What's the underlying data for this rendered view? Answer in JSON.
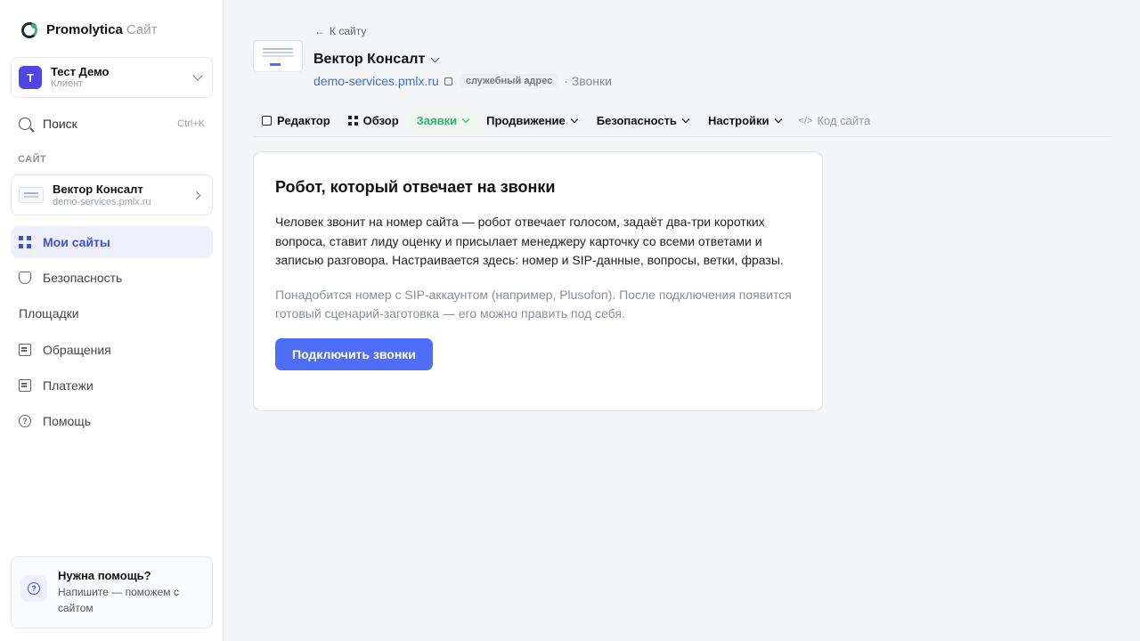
{
  "brand": {
    "name": "Promolytica",
    "suffix": "Сайт"
  },
  "account": {
    "initial": "Т",
    "name": "Тест Демо",
    "role": "Клиент"
  },
  "search": {
    "label": "Поиск",
    "shortcut": "Ctrl+K"
  },
  "sidebar": {
    "section_label": "САЙТ",
    "site": {
      "name": "Вектор Консалт",
      "url": "demo-services.pmlx.ru"
    },
    "items": [
      {
        "label": "Мои сайты"
      },
      {
        "label": "Безопасность"
      },
      {
        "label": "Площадки"
      },
      {
        "label": "Обращения"
      },
      {
        "label": "Платежи"
      },
      {
        "label": "Помощь"
      }
    ],
    "help": {
      "title": "Нужна помощь?",
      "desc": "Напишите — поможем с сайтом"
    }
  },
  "header": {
    "back_label": "К сайту",
    "title": "Вектор Консалт",
    "domain": "demo-services.pmlx.ru",
    "badge": "служебный адрес",
    "crumb": "· Звонки"
  },
  "tabs": [
    {
      "label": "Редактор"
    },
    {
      "label": "Обзор"
    },
    {
      "label": "Заявки"
    },
    {
      "label": "Продвижение"
    },
    {
      "label": "Безопасность"
    },
    {
      "label": "Настройки"
    },
    {
      "label": "Код сайта"
    }
  ],
  "card": {
    "title": "Робот, который отвечает на звонки",
    "body": "Человек звонит на номер сайта — робот отвечает голосом, задаёт два-три коротких вопроса, ставит лиду оценку и присылает менеджеру карточку со всеми ответами и записью разговора. Настраивается здесь: номер и SIP-данные, вопросы, ветки, фразы.",
    "note": "Понадобится номер с SIP-аккаунтом (например, Plusofon). После подключения появится готовый сценарий-заготовка — его можно править под себя.",
    "cta": "Подключить звонки"
  },
  "colors": {
    "accent": "#4f6ef7",
    "active_tab": "#2bb46c",
    "sidebar_active_bg": "#eef0fd"
  }
}
